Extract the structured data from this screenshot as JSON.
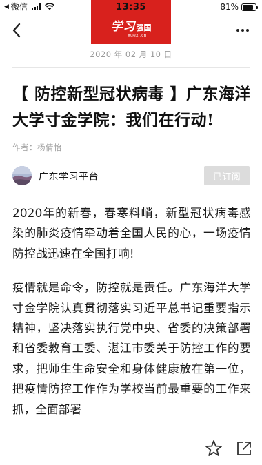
{
  "status_bar": {
    "app": "微信",
    "time": "13:35",
    "battery": "81%",
    "battery_level": 0.81
  },
  "brand": {
    "logo_main": "学习",
    "logo_sub": "强国",
    "url": "xuexi.cn"
  },
  "nav": {
    "back_icon": "chevron-left-icon",
    "more_icon": "more-horizontal-icon"
  },
  "article": {
    "date": "2020 年 02 月 10 日",
    "title": "【 防控新型冠状病毒 】广东海洋大学寸金学院：我们在行动!",
    "author": "作者：杨倩怡",
    "source_name": "广东学习平台",
    "subscribe_label": "已订阅",
    "paragraphs": [
      "2020年的新春，春寒料峭，新型冠状病毒感染的肺炎疫情牵动着全国人民的心，一场疫情防控战迅速在全国打响!",
      "疫情就是命令，防控就是责任。广东海洋大学寸金学院认真贯彻落实习近平总书记重要指示精神，坚决落实执行党中央、省委的决策部署和省委教育工委、湛江市委关于防控工作的要求，把师生生命安全和身体健康放在第一位，把疫情防控工作作为学校当前最重要的工作来抓，全面部署"
    ]
  },
  "bottom_bar": {
    "favorite_icon": "star-icon",
    "share_icon": "share-icon"
  },
  "colors": {
    "brand_red": "#d8211d",
    "muted_text": "#9a9a9a",
    "subscribe_bg": "#dcdcdc"
  }
}
